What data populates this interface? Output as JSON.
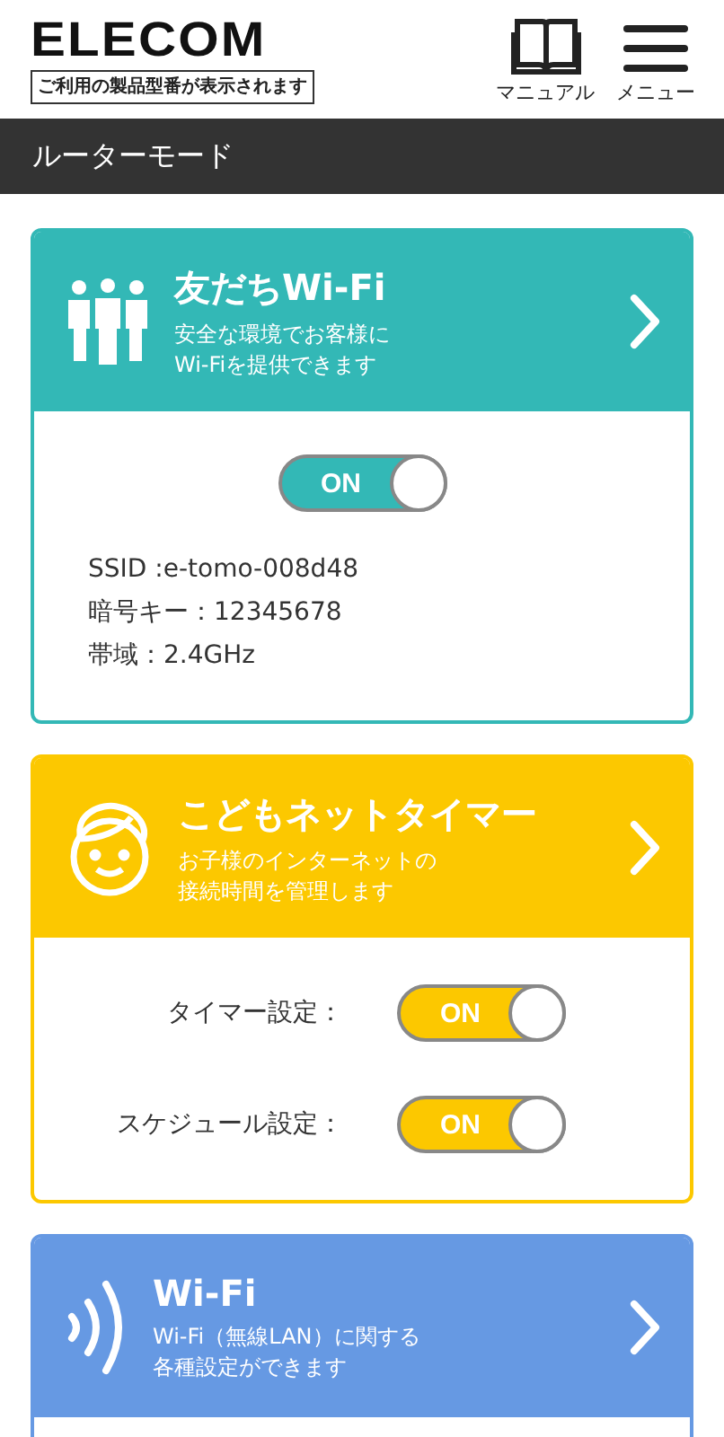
{
  "header": {
    "logo": "ELECOM",
    "model_note": "ご利用の製品型番が表示されます",
    "manual_label": "マニュアル",
    "menu_label": "メニュー"
  },
  "mode_bar": {
    "title": "ルーターモード"
  },
  "cards": [
    {
      "kind": "friends",
      "color": "#33b8b6",
      "title": "友だちWi-Fi",
      "description": [
        "安全な環境でお客様に",
        "Wi-Fiを提供できます"
      ],
      "body": {
        "kind": "info",
        "toggle": {
          "label": "ON",
          "on": true
        },
        "lines": [
          "SSID :e-tomo-008d48",
          "暗号キー：12345678",
          "帯域：2.4GHz"
        ]
      }
    },
    {
      "kind": "kids",
      "color": "#fcc800",
      "title": "こどもネットタイマー",
      "description": [
        "お子様のインターネットの",
        "接続時間を管理します"
      ],
      "body": {
        "kind": "settings",
        "rows": [
          {
            "label": "タイマー設定：",
            "toggle": {
              "label": "ON",
              "on": true
            }
          },
          {
            "label": "スケジュール設定：",
            "toggle": {
              "label": "ON",
              "on": true
            }
          }
        ]
      }
    },
    {
      "kind": "wifi",
      "color": "#6699e3",
      "title": "Wi-Fi",
      "description": [
        "Wi-Fi（無線LAN）に関する",
        "各種設定ができます"
      ],
      "body": {
        "kind": "empty"
      }
    }
  ]
}
